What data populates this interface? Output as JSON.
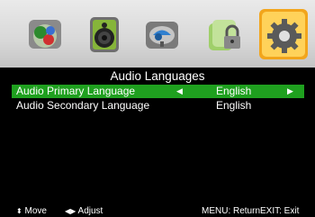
{
  "menu_categories": [
    {
      "name": "picture-category",
      "icon": "picture-icon"
    },
    {
      "name": "sound-category",
      "icon": "speaker-icon"
    },
    {
      "name": "channel-category",
      "icon": "satellite-dish-icon"
    },
    {
      "name": "lock-category",
      "icon": "lock-icon"
    },
    {
      "name": "setup-category",
      "icon": "gear-icon",
      "selected": true
    }
  ],
  "page": {
    "title": "Audio Languages"
  },
  "rows": [
    {
      "label": "Audio Primary Language",
      "value": "English",
      "selected": true
    },
    {
      "label": "Audio Secondary Language",
      "value": "English",
      "selected": false
    }
  ],
  "footer": {
    "move": "Move",
    "adjust": "Adjust",
    "menu": "MENU: Return",
    "exit": "EXIT: Exit"
  },
  "colors": {
    "highlight": "#1fa01f",
    "background": "#000000",
    "header": "#d8d8d8"
  }
}
